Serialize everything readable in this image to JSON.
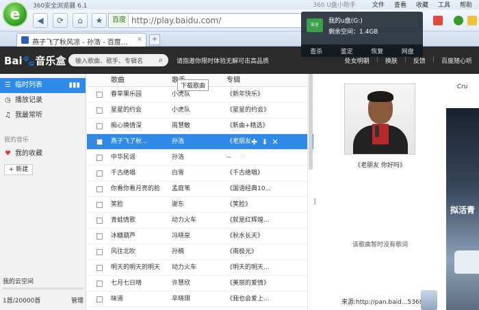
{
  "browser": {
    "title": "360安全浏览器 6.1",
    "logo_letter": "e",
    "helper": "360 U盘小助手",
    "menu": [
      "文件",
      "查看",
      "收藏",
      "工具",
      "帮助"
    ],
    "address_site": "百度",
    "address_url": "http://play.baidu.com/",
    "tab_title": "燕子飞了秋风凉 - 孙浩 - 百度...",
    "tab_close": "×",
    "new_tab": "+"
  },
  "usb_popup": {
    "disk_label": "安全",
    "name": "我的u盘(G:)",
    "space": "剩余空间：1.4GB",
    "actions": [
      "查杀",
      "鉴定",
      "恢复",
      "网盘"
    ]
  },
  "header": {
    "logo_text": "Bai",
    "logo_paw": "🐾",
    "logo_suffix": "音乐盒",
    "search_placeholder": "输入歌曲、歌手、专辑名",
    "promo": "请指邀你限时体验无解可击高品质",
    "user": "处女明朝",
    "skin": "换肤",
    "feedback": "反馈",
    "listen": "百度随心听"
  },
  "sidebar": {
    "items": [
      {
        "label": "临时列表",
        "icon": "list-icon"
      },
      {
        "label": "播放记录",
        "icon": "history-icon"
      },
      {
        "label": "我最常听",
        "icon": "headphone-icon"
      }
    ],
    "my_music": "我的音乐",
    "favorites": "我的收藏",
    "new_button": "+ 新建",
    "cloud_title": "我的云空间",
    "cloud_count": "1首/20000首",
    "cloud_manage": "管理"
  },
  "columns": {
    "title": "歌曲",
    "artist": "歌手",
    "album": "专辑"
  },
  "songs": [
    {
      "title": "春草果乐园",
      "artist": "小虎队",
      "album": "《新年快乐》"
    },
    {
      "title": "星星的约会",
      "artist": "小虎队",
      "album": "《星星的约会》"
    },
    {
      "title": "痴心换情深",
      "artist": "周慧敏",
      "album": "《新曲+精选》"
    },
    {
      "title": "燕子飞了秋...",
      "artist": "孙浩",
      "album": "《老朋友"
    },
    {
      "title": "中华民谣",
      "artist": "孙浩",
      "album": "--"
    },
    {
      "title": "千古绝唱",
      "artist": "白雪",
      "album": "《千古绝唱》"
    },
    {
      "title": "你看你看月亮的脸",
      "artist": "孟庭苇",
      "album": "《国语经典10..."
    },
    {
      "title": "笑脸",
      "artist": "谢东",
      "album": "《笑脸》"
    },
    {
      "title": "青蛙情歌",
      "artist": "动力火车",
      "album": "《就是红辉煌..."
    },
    {
      "title": "冰糖葫芦",
      "artist": "冯晓泉",
      "album": "《秋水长天》"
    },
    {
      "title": "风往北吹",
      "artist": "孙楠",
      "album": "《南极光》"
    },
    {
      "title": "明天的明天的明天",
      "artist": "动力火车",
      "album": "《明天的明天..."
    },
    {
      "title": "七月七日晴",
      "artist": "许慧欣",
      "album": "《美丽的爱情》"
    },
    {
      "title": "味道",
      "artist": "辛晓琪",
      "album": "《我也会爱上..."
    }
  ],
  "tooltip": "下载歌曲",
  "right": {
    "album_title": "《老朋友 你好吗》",
    "no_lyrics": "该歌曲暂时没有歌词",
    "source": "来源:http://pan.baid...53683"
  },
  "ad": {
    "brand": "Cru",
    "slogan": "拟活青"
  }
}
